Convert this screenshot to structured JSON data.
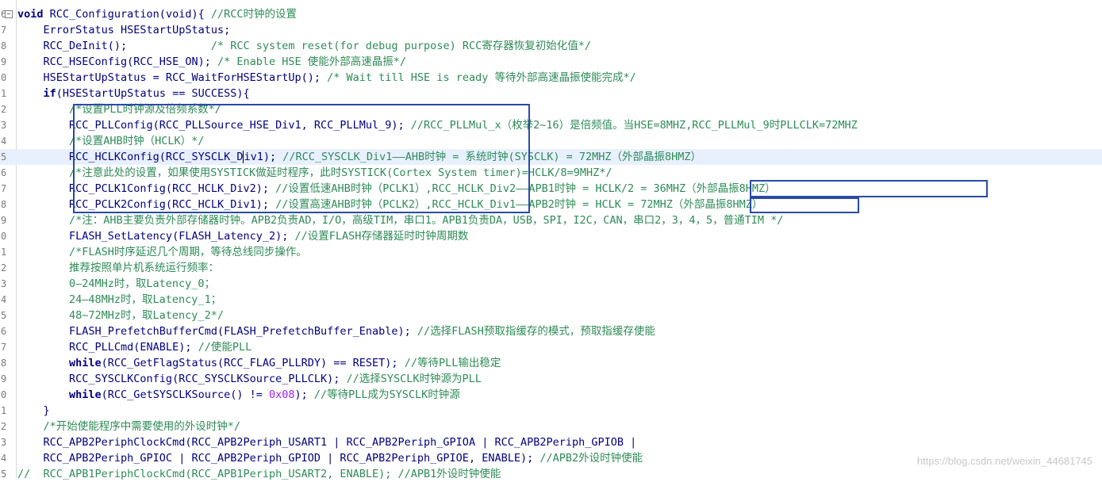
{
  "lines": [
    {
      "num": "6",
      "fold": "⊟",
      "parts": [
        [
          "kw",
          "void "
        ],
        [
          "",
          "RCC_Configuration(void){ "
        ],
        [
          "cm",
          "//RCC时钟的设置"
        ]
      ]
    },
    {
      "num": "7",
      "parts": [
        [
          "",
          "    ErrorStatus HSEStartUpStatus;"
        ]
      ]
    },
    {
      "num": "8",
      "parts": [
        [
          "",
          "    RCC_DeInit();             "
        ],
        [
          "cm",
          "/* RCC system reset(for debug purpose) RCC寄存器恢复初始化值*/"
        ]
      ]
    },
    {
      "num": "9",
      "parts": [
        [
          "",
          "    RCC_HSEConfig(RCC_HSE_ON); "
        ],
        [
          "cm",
          "/* Enable HSE 使能外部高速晶振*/"
        ]
      ]
    },
    {
      "num": "0",
      "parts": [
        [
          "",
          "    HSEStartUpStatus = RCC_WaitForHSEStartUp(); "
        ],
        [
          "cm",
          "/* Wait till HSE is ready 等待外部高速晶振使能完成*/"
        ]
      ]
    },
    {
      "num": "1",
      "parts": [
        [
          "kw",
          "    if"
        ],
        [
          "",
          "(HSEStartUpStatus == SUCCESS){"
        ]
      ]
    },
    {
      "num": "2",
      "parts": [
        [
          "cm",
          "        /*设置PLL时钟源及倍频系数*/"
        ]
      ]
    },
    {
      "num": "3",
      "parts": [
        [
          "",
          "        RCC_PLLConfig(RCC_PLLSource_HSE_Div1, RCC_PLLMul_9); "
        ],
        [
          "cm",
          "//RCC_PLLMul_x（枚举2~16）是倍频值。当HSE=8MHZ,RCC_PLLMul_9时PLLCLK=72MHZ"
        ]
      ]
    },
    {
      "num": "4",
      "parts": [
        [
          "cm",
          "        /*设置AHB时钟（HCLK）*/"
        ]
      ]
    },
    {
      "num": "5",
      "highlight": true,
      "parts": [
        [
          "",
          "        RCC_HCLKConfig(RCC_SYSCLK_D"
        ],
        [
          "caret",
          ""
        ],
        [
          "",
          "iv1); "
        ],
        [
          "cm",
          "//RCC_SYSCLK_Div1——AHB时钟 = 系统时钟(SYSCLK) = 72MHZ（外部晶振8HMZ）"
        ]
      ]
    },
    {
      "num": "6",
      "parts": [
        [
          "cm",
          "        /*注意此处的设置，如果使用SYSTICK做延时程序，此时SYSTICK(Cortex System timer)=HCLK/8=9MHZ*/"
        ]
      ]
    },
    {
      "num": "7",
      "parts": [
        [
          "",
          "        RCC_PCLK1Config(RCC_HCLK_Div2); "
        ],
        [
          "cm",
          "//设置低速AHB时钟（PCLK1）,RCC_HCLK_Div2——APB1时钟 = HCLK/2 = 36MHZ（外部晶振8HMZ）"
        ]
      ]
    },
    {
      "num": "8",
      "parts": [
        [
          "",
          "        RCC_PCLK2Config(RCC_HCLK_Div1); "
        ],
        [
          "cm",
          "//设置高速AHB时钟（PCLK2）,RCC_HCLK_Div1——APB2时钟 = HCLK = 72MHZ（外部晶振8HMZ）"
        ]
      ]
    },
    {
      "num": "9",
      "parts": [
        [
          "cm",
          "        /*注：AHB主要负责外部存储器时钟。APB2负责AD，I/O，高级TIM，串口1。APB1负责DA，USB，SPI，I2C，CAN，串口2，3，4，5，普通TIM */"
        ]
      ]
    },
    {
      "num": "0",
      "parts": [
        [
          "",
          "        FLASH_SetLatency(FLASH_Latency_2); "
        ],
        [
          "cm",
          "//设置FLASH存储器延时时钟周期数"
        ]
      ]
    },
    {
      "num": "1",
      "parts": [
        [
          "cm",
          "        /*FLASH时序延迟几个周期，等待总线同步操作。"
        ]
      ]
    },
    {
      "num": "2",
      "parts": [
        [
          "cm",
          "        推荐按照单片机系统运行频率："
        ]
      ]
    },
    {
      "num": "3",
      "parts": [
        [
          "cm",
          "        0—24MHz时，取Latency_0；"
        ]
      ]
    },
    {
      "num": "4",
      "parts": [
        [
          "cm",
          "        24—48MHz时，取Latency_1；"
        ]
      ]
    },
    {
      "num": "5",
      "parts": [
        [
          "cm",
          "        48~72MHz时，取Latency_2*/"
        ]
      ]
    },
    {
      "num": "6",
      "parts": [
        [
          "",
          "        FLASH_PrefetchBufferCmd(FLASH_PrefetchBuffer_Enable); "
        ],
        [
          "cm",
          "//选择FLASH预取指缓存的模式，预取指缓存使能"
        ]
      ]
    },
    {
      "num": "7",
      "parts": [
        [
          "",
          "        RCC_PLLCmd(ENABLE); "
        ],
        [
          "cm",
          "//使能PLL"
        ]
      ]
    },
    {
      "num": "8",
      "parts": [
        [
          "kw",
          "        while"
        ],
        [
          "",
          "(RCC_GetFlagStatus(RCC_FLAG_PLLRDY) == RESET); "
        ],
        [
          "cm",
          "//等待PLL输出稳定"
        ]
      ]
    },
    {
      "num": "9",
      "parts": [
        [
          "",
          "        RCC_SYSCLKConfig(RCC_SYSCLKSource_PLLCLK); "
        ],
        [
          "cm",
          "//选择SYSCLK时钟源为PLL"
        ]
      ]
    },
    {
      "num": "0",
      "parts": [
        [
          "kw",
          "        while"
        ],
        [
          "",
          "(RCC_GetSYSCLKSource() != "
        ],
        [
          "num",
          "0x08"
        ],
        [
          "",
          "); "
        ],
        [
          "cm",
          "//等待PLL成为SYSCLK时钟源"
        ]
      ]
    },
    {
      "num": "1",
      "parts": [
        [
          "",
          "    }"
        ]
      ]
    },
    {
      "num": "2",
      "parts": [
        [
          "cm",
          "    /*开始使能程序中需要使用的外设时钟*/"
        ]
      ]
    },
    {
      "num": "3",
      "parts": [
        [
          "",
          "    RCC_APB2PeriphClockCmd(RCC_APB2Periph_USART1 | RCC_APB2Periph_GPIOA | RCC_APB2Periph_GPIOB |"
        ]
      ]
    },
    {
      "num": "4",
      "parts": [
        [
          "",
          "    RCC_APB2Periph_GPIOC | RCC_APB2Periph_GPIOD | RCC_APB2Periph_GPIOE, ENABLE); "
        ],
        [
          "cm",
          "//APB2外设时钟使能"
        ]
      ]
    },
    {
      "num": "5",
      "parts": [
        [
          "cm",
          "//  RCC_APB1PeriphClockCmd(RCC_APB1Periph_USART2, ENABLE); //APB1外设时钟使能"
        ]
      ]
    }
  ],
  "watermark": "https://blog.csdn.net/weixin_44681745",
  "colors": {
    "annotation_border": "#2a4aa8",
    "comment": "#2e8b57",
    "code": "#000080",
    "current_line": "#e8f0fe"
  }
}
